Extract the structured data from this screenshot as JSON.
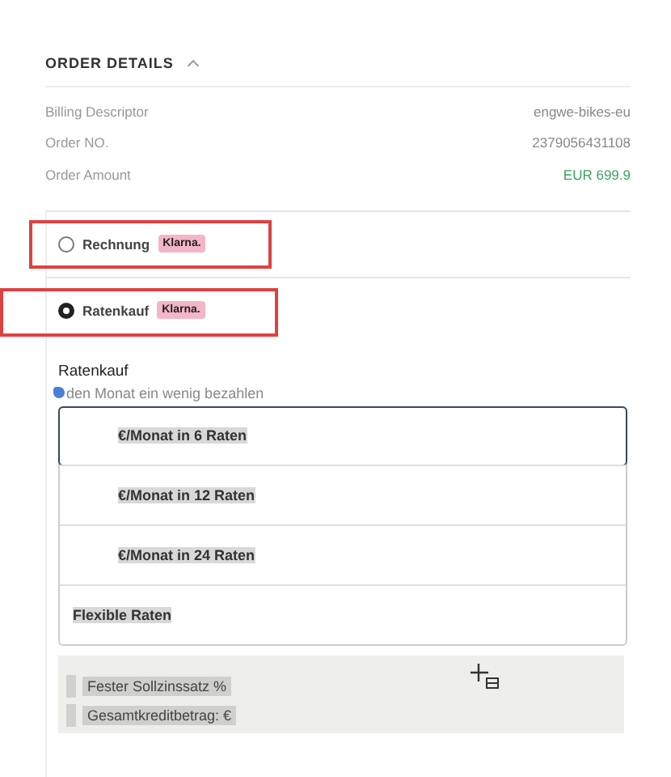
{
  "order_details": {
    "title": "ORDER DETAILS",
    "expanded": true,
    "rows": [
      {
        "label": "Billing Descriptor",
        "value": "engwe-bikes-eu",
        "kind": "plain"
      },
      {
        "label": "Order NO.",
        "value": "2379056431108",
        "kind": "plain"
      },
      {
        "label": "Order Amount",
        "value": "EUR 699.9",
        "kind": "amount"
      }
    ]
  },
  "payment_methods": [
    {
      "label": "Rechnung",
      "badge": "Klarna.",
      "selected": false,
      "highlighted": true
    },
    {
      "label": "Ratenkauf",
      "badge": "Klarna.",
      "selected": true,
      "highlighted": true
    }
  ],
  "installments": {
    "title": "Ratenkauf",
    "subtitle": "den Monat ein wenig bezahlen",
    "options": [
      {
        "label": "€/Monat in 6 Raten",
        "selected": true
      },
      {
        "label": "€/Monat in 12 Raten",
        "selected": false
      },
      {
        "label": "€/Monat in 24 Raten",
        "selected": false
      },
      {
        "label": "Flexible Raten",
        "selected": false
      }
    ],
    "details": [
      "Fester Sollzinssatz %",
      "Gesamtkreditbetrag: €"
    ]
  }
}
